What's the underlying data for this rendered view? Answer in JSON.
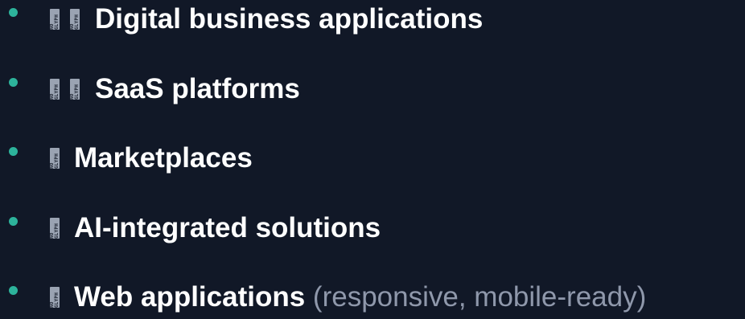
{
  "colors": {
    "background": "#111827",
    "bullet": "#2db39b",
    "text": "#ffffff",
    "muted_text": "#8f98ab",
    "missing_glyph_box": "#9aa3b2"
  },
  "missing_glyph_label": "NO GLYPH",
  "items": [
    {
      "label": "Digital business applications",
      "note": "",
      "missing_glyphs": 2
    },
    {
      "label": "SaaS platforms",
      "note": "",
      "missing_glyphs": 2
    },
    {
      "label": "Marketplaces",
      "note": "",
      "missing_glyphs": 1
    },
    {
      "label": "AI-integrated solutions",
      "note": "",
      "missing_glyphs": 1
    },
    {
      "label": "Web applications",
      "note": "(responsive, mobile-ready)",
      "missing_glyphs": 1
    }
  ]
}
